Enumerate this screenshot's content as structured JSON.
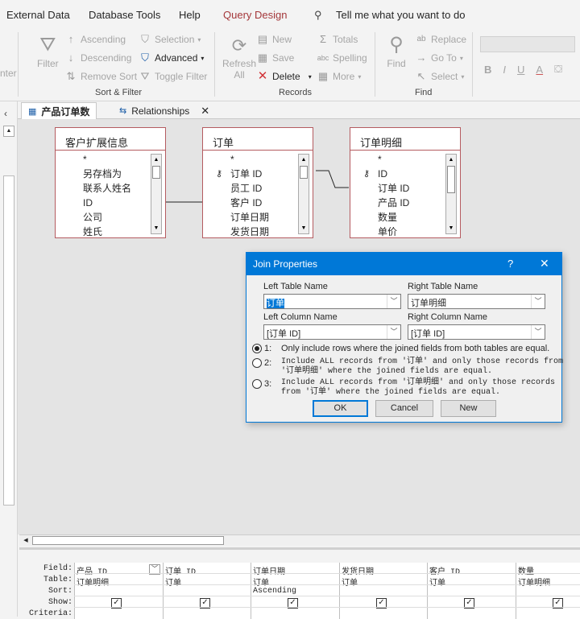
{
  "ribbon_tabs": [
    {
      "label": "External Data"
    },
    {
      "label": "Database Tools"
    },
    {
      "label": "Help"
    },
    {
      "label": "Query Design",
      "active": true
    }
  ],
  "tell_me": "Tell me what you want to do",
  "ribbon": {
    "partial_left": "nter",
    "filter": "Filter",
    "ascending": "Ascending",
    "descending": "Descending",
    "remove_sort": "Remove Sort",
    "selection": "Selection",
    "advanced": "Advanced",
    "toggle_filter": "Toggle Filter",
    "sort_filter_group": "Sort & Filter",
    "refresh_all": "Refresh All",
    "refresh": "Refresh",
    "all": "All",
    "new": "New",
    "save": "Save",
    "delete": "Delete",
    "totals": "Totals",
    "spelling": "Spelling",
    "more": "More",
    "records_group": "Records",
    "find": "Find",
    "replace": "Replace",
    "goto": "Go To",
    "select": "Select",
    "find_group": "Find",
    "bold": "B",
    "italic": "I",
    "underline": "U"
  },
  "doc_tabs": [
    {
      "label": "产品订单数",
      "active": true
    },
    {
      "label": "Relationships",
      "active": false
    }
  ],
  "tables": [
    {
      "title": "客户扩展信息",
      "fields": [
        "*",
        "另存档为",
        "联系人姓名",
        "ID",
        "公司",
        "姓氏"
      ]
    },
    {
      "title": "订单",
      "fields": [
        "*",
        "订单 ID",
        "员工 ID",
        "客户 ID",
        "订单日期",
        "发货日期"
      ],
      "key": "订单 ID"
    },
    {
      "title": "订单明细",
      "fields": [
        "*",
        "ID",
        "订单 ID",
        "产品 ID",
        "数量",
        "单价"
      ],
      "key": "ID"
    }
  ],
  "dialog": {
    "title": "Join Properties",
    "help": "?",
    "close": "✕",
    "left_table_label": "Left Table Name",
    "left_table_value": "订单",
    "right_table_label": "Right Table Name",
    "right_table_value": "订单明细",
    "left_column_label": "Left Column Name",
    "left_column_value": "[订单 ID]",
    "right_column_label": "Right Column Name",
    "right_column_value": "[订单 ID]",
    "options": [
      {
        "num": "1:",
        "line1": "Only include rows where the joined fields from both tables are equal.",
        "line2": "",
        "selected": true
      },
      {
        "num": "2:",
        "line1": "Include ALL records from '订单' and only those records from",
        "line2": "'订单明细' where the joined fields are equal.",
        "selected": false
      },
      {
        "num": "3:",
        "line1": "Include ALL records from '订单明细' and only those records",
        "line2": "from '订单' where the joined fields are equal.",
        "selected": false
      }
    ],
    "ok": "OK",
    "cancel": "Cancel",
    "new": "New"
  },
  "grid": {
    "labels": {
      "field": "Field:",
      "table": "Table:",
      "sort": "Sort:",
      "show": "Show:",
      "criteria": "Criteria:"
    },
    "columns": [
      {
        "field": "产品 ID",
        "table": "订单明细",
        "sort": "",
        "show": true
      },
      {
        "field": "订单 ID",
        "table": "订单",
        "sort": "",
        "show": true
      },
      {
        "field": "订单日期",
        "table": "订单",
        "sort": "Ascending",
        "show": true
      },
      {
        "field": "发货日期",
        "table": "订单",
        "sort": "",
        "show": true
      },
      {
        "field": "客户 ID",
        "table": "订单",
        "sort": "",
        "show": true
      },
      {
        "field": "数量",
        "table": "订单明细",
        "sort": "",
        "show": true
      }
    ]
  },
  "colors": {
    "accent": "#0078d7",
    "active_tab": "#a4373a",
    "table_border": "#b55b60"
  }
}
